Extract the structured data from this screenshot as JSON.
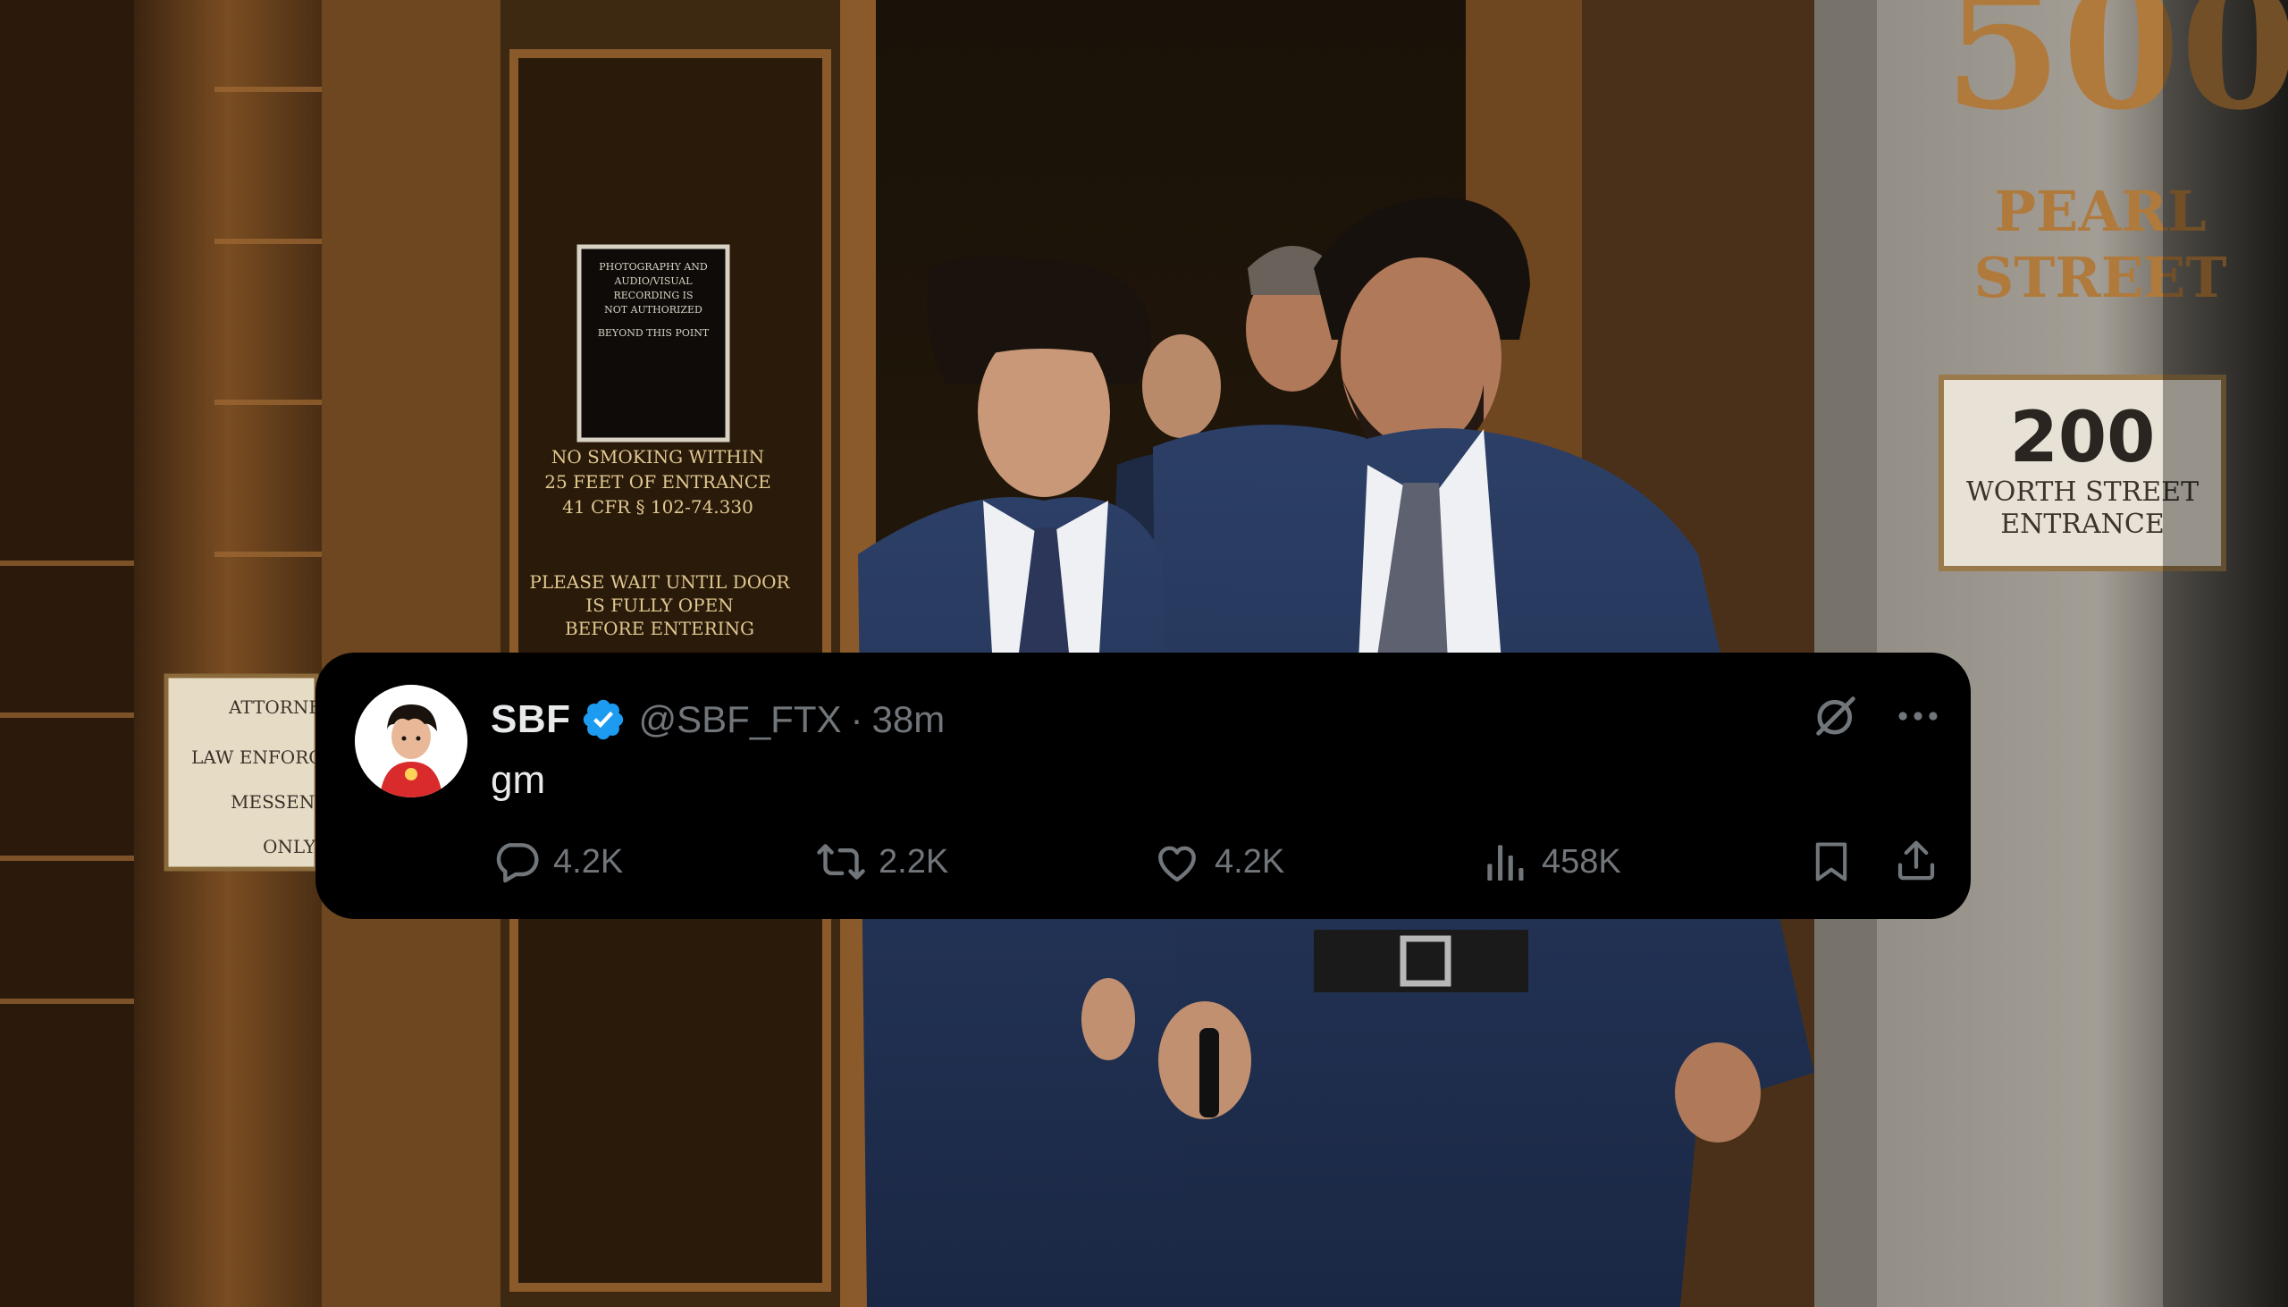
{
  "background": {
    "building_number": "500",
    "street_line1": "PEARL",
    "street_line2": "STREET",
    "plaque_number": "200",
    "plaque_line1": "WORTH STREET",
    "plaque_line2": "ENTRANCE",
    "door_sign_title": [
      "PHOTOGRAPHY AND",
      "AUDIO/VISUAL",
      "RECORDING IS",
      "NOT AUTHORIZED"
    ],
    "door_sign_sub": "BEYOND THIS POINT",
    "no_smoking": [
      "NO SMOKING WITHIN",
      "25 FEET OF ENTRANCE",
      "41 CFR § 102-74.330"
    ],
    "wait_sign": [
      "PLEASE WAIT UNTIL DOOR",
      "IS FULLY OPEN",
      "BEFORE ENTERING"
    ],
    "attorney_sign": [
      "ATTORNE",
      "LAW ENFORC",
      "MESSENG",
      "ONLY"
    ]
  },
  "tweet": {
    "display_name": "SBF",
    "handle": "@SBF_FTX",
    "separator": "·",
    "time": "38m",
    "text": "gm",
    "verified_color": "#1d9bf0",
    "stats": {
      "replies": "4.2K",
      "reposts": "2.2K",
      "likes": "4.2K",
      "views": "458K"
    },
    "icons": {
      "reply": "comment-bubble-icon",
      "repost": "repost-arrows-icon",
      "like": "heart-icon",
      "views": "analytics-bars-icon",
      "bookmark": "bookmark-icon",
      "share": "share-upload-icon",
      "grok": "grok-slash-circle-icon",
      "more": "more-dots-icon"
    }
  }
}
